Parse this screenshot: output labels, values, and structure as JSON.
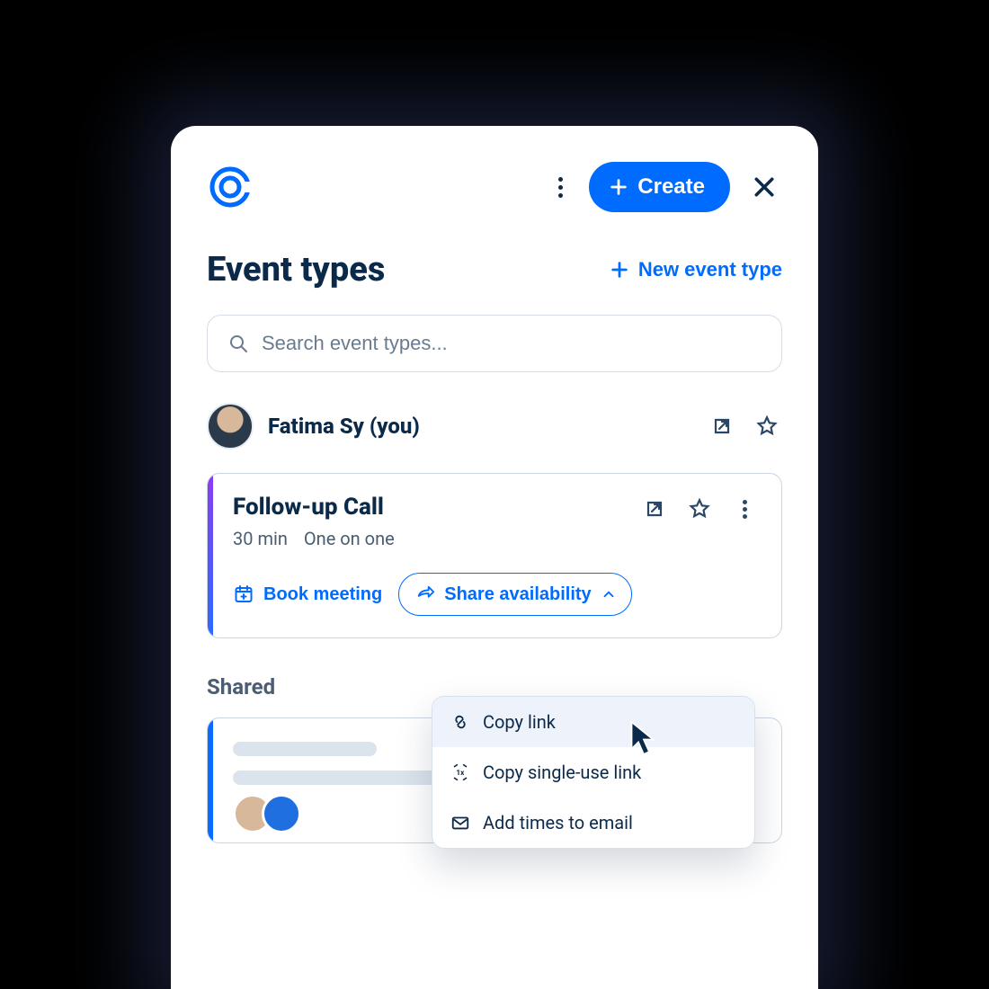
{
  "header": {
    "create_label": "Create"
  },
  "page": {
    "title": "Event types",
    "new_event_label": "New event type"
  },
  "search": {
    "placeholder": "Search event types..."
  },
  "user": {
    "name": "Fatima Sy (you)"
  },
  "event": {
    "title": "Follow-up Call",
    "duration": "30 min",
    "kind": "One on one",
    "book_label": "Book meeting",
    "share_label": "Share availability"
  },
  "sections": {
    "shared_label": "Shared"
  },
  "dropdown": {
    "copy_link": "Copy link",
    "copy_single_use": "Copy single-use link",
    "add_times": "Add times to email"
  }
}
